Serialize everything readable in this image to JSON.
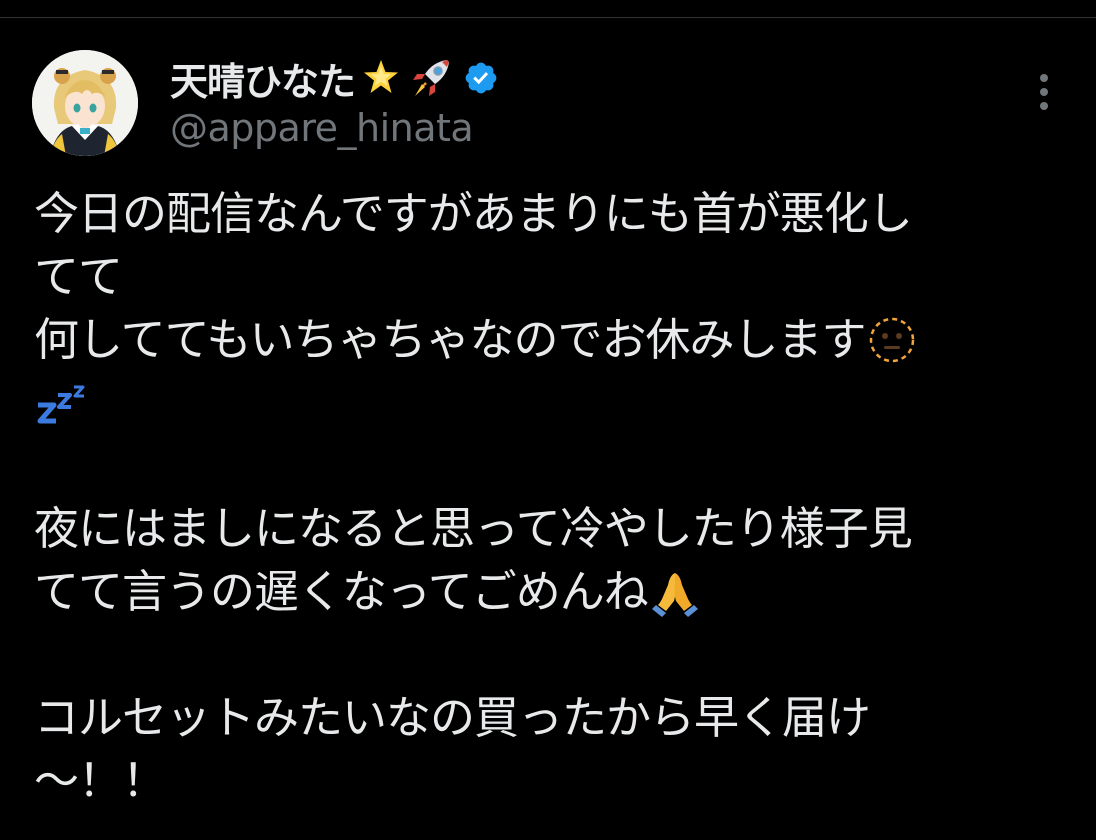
{
  "tweet": {
    "display_name": "天晴ひなた",
    "handle": "@appare_hinata",
    "name_emojis": [
      "glowing-star",
      "rocket"
    ],
    "verified": true,
    "lines": [
      "今日の配信なんですがあまりにも首が悪化し",
      "てて",
      "何しててもいちゃちゃなのでお休みします",
      "",
      "",
      "夜にはましになると思って冷やしたり様子見",
      "てて言うの遅くなってごめんね",
      "",
      "コルセットみたいなの買ったから早く届け",
      "〜！！"
    ],
    "line_emojis": {
      "line3": "dotted-line-face",
      "line4": "zzz",
      "line7": "folded-hands"
    }
  },
  "colors": {
    "background": "#000000",
    "text": "#e7e9ea",
    "secondary": "#71767b",
    "verified": "#1d9bf0",
    "divider": "#2f3336"
  }
}
